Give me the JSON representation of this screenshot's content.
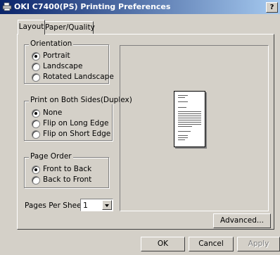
{
  "window": {
    "title": "OKI C7400(PS) Printing Preferences",
    "help_label": "?"
  },
  "tabs": [
    {
      "label": "Layout",
      "active": true
    },
    {
      "label": "Paper/Quality",
      "active": false
    }
  ],
  "orientation": {
    "legend": "Orientation",
    "options": [
      "Portrait",
      "Landscape",
      "Rotated Landscape"
    ],
    "selected": "Portrait"
  },
  "duplex": {
    "legend": "Print on Both Sides(Duplex)",
    "options": [
      "None",
      "Flip on Long Edge",
      "Flip on Short Edge"
    ],
    "selected": "None"
  },
  "page_order": {
    "legend": "Page Order",
    "options": [
      "Front to Back",
      "Back to Front"
    ],
    "selected": "Front to Back"
  },
  "pages_per_sheet": {
    "label": "Pages Per Sheet:",
    "value": "1"
  },
  "buttons": {
    "advanced": "Advanced...",
    "ok": "OK",
    "cancel": "Cancel",
    "apply": "Apply"
  },
  "icons": {
    "app": "printer-icon",
    "dropdown": "chevron-down-icon"
  }
}
